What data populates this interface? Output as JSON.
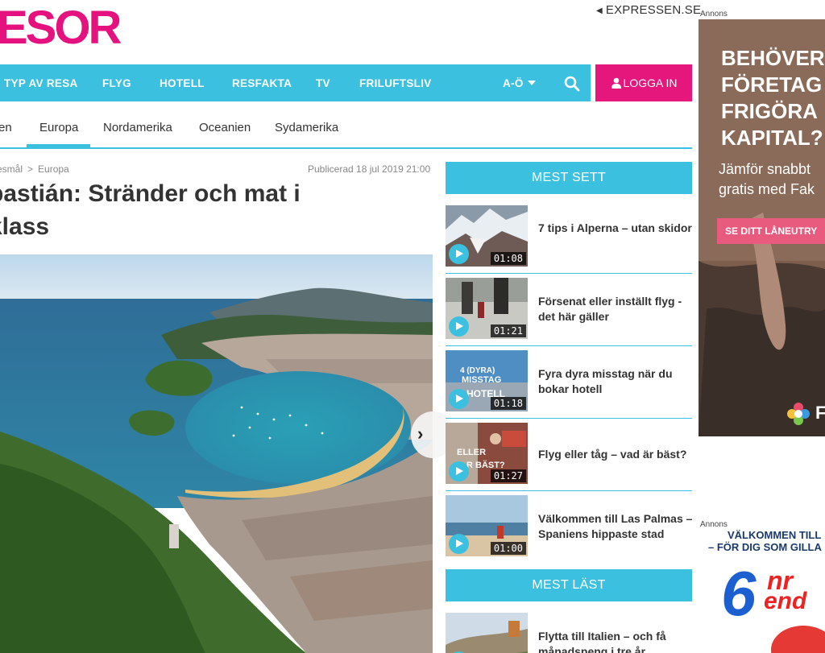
{
  "header": {
    "logo": "ESOR",
    "expressen_link": "EXPRESSEN.SE"
  },
  "nav": {
    "items": [
      "TYP AV RESA",
      "FLYG",
      "HOTELL",
      "RESFAKTA",
      "TV",
      "FRILUFTSLIV",
      "A-Ö"
    ],
    "login_label": "LOGGA IN"
  },
  "subnav": {
    "items": [
      "en",
      "Europa",
      "Nordamerika",
      "Oceanien",
      "Sydamerika"
    ],
    "active": "Europa"
  },
  "article": {
    "breadcrumb": [
      "esmål",
      "Europa"
    ],
    "breadcrumb_sep": ">",
    "published": "Publicerad 18 jul 2019 21:00",
    "headline_line1": "bastián: Stränder och mat i",
    "headline_line2": "klass"
  },
  "sidebar": {
    "most_viewed_title": "MEST SETT",
    "videos": [
      {
        "title": "7 tips i Alperna – utan skidor",
        "duration": "01:08"
      },
      {
        "title": "Försenat eller inställt flyg - det här gäller",
        "duration": "01:21"
      },
      {
        "title": "Fyra dyra misstag när du bokar hotell",
        "duration": "01:18"
      },
      {
        "title": "Flyg eller tåg – vad är bäst?",
        "duration": "01:27"
      },
      {
        "title": "Välkommen till Las Palmas – Spaniens hippaste stad",
        "duration": "01:00"
      }
    ],
    "most_read_title": "MEST LÄST",
    "most_read": [
      {
        "title": "Flytta till Italien – och få månadspeng i tre år"
      }
    ]
  },
  "ads": {
    "label": "Annons",
    "ad1_lines": [
      "BEHÖVER",
      "FÖRETAG",
      "FRIGÖRA",
      "KAPITAL?"
    ],
    "ad1_sub_lines": [
      "Jämför snabbt",
      "gratis med Fak"
    ],
    "ad1_cta": "SE DITT LÅNEUTRY",
    "ad1_logo_letter": "F",
    "ad2_lines": [
      "VÄLKOMMEN TILL",
      "– FÖR DIG SOM GILLA"
    ],
    "ad2_big": "6",
    "ad2_word": "nr",
    "ad2_word2": "end"
  },
  "thumb_texts": {
    "t3": [
      "4 (DYRA)",
      "MISSTAG",
      "HOTELL"
    ],
    "t4": [
      "ELLER",
      "R BÄST?"
    ]
  },
  "colors": {
    "brand_pink": "#e4117e",
    "nav_blue": "#3cc0df",
    "login_pink": "#e5167c"
  }
}
